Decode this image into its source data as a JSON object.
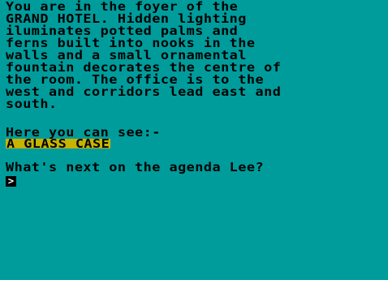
{
  "description_lines": [
    "You are in the foyer of the",
    "GRAND HOTEL. Hidden lighting",
    "iluminates potted palms and",
    "ferns built into nooks in the",
    "walls and a small ornamental",
    "fountain decorates the centre of",
    "the room. The office is to the",
    "west and corridors lead east and",
    "south."
  ],
  "items_heading": "Here you can see:-",
  "items": [
    "A GLASS CASE"
  ],
  "prompt_text": "What's next on the agenda Lee?",
  "cursor_glyph": ">",
  "colors": {
    "background": "#009c9c",
    "text": "#000000",
    "item_highlight": "#c8b400"
  }
}
